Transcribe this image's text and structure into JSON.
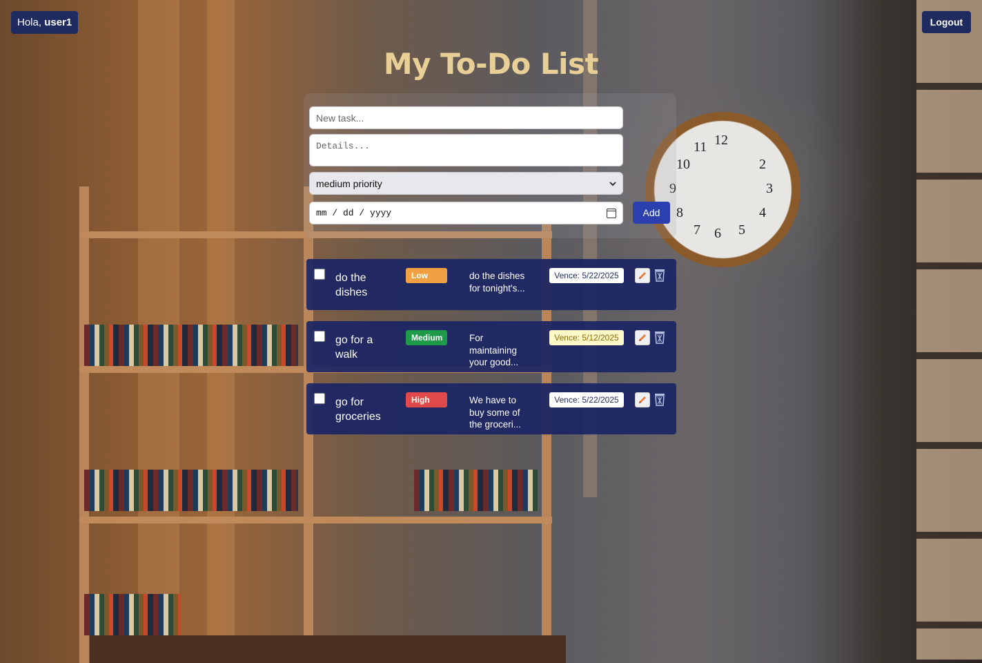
{
  "header": {
    "greeting_prefix": "Hola,",
    "username": "user1",
    "logout_label": "Logout"
  },
  "title": "My To-Do List",
  "form": {
    "task_placeholder": "New task...",
    "details_placeholder": "Details...",
    "priority_selected": "medium priority",
    "date_placeholder": "mm / dd / yyyy",
    "add_label": "Add"
  },
  "tasks": [
    {
      "name": "do the dishes",
      "priority": "Low",
      "priority_color": "#f0a040",
      "description": "do the dishes for tonight's...",
      "due": "Vence: 5/22/2025",
      "due_style": "normal"
    },
    {
      "name": "go for a walk",
      "priority": "Medium",
      "priority_color": "#1f9a4a",
      "description": "For maintaining your good...",
      "due": "Vence: 5/12/2025",
      "due_style": "warning"
    },
    {
      "name": "go for groceries",
      "priority": "High",
      "priority_color": "#e04a4a",
      "description": "We have to buy some of the groceri...",
      "due": "Vence: 5/22/2025",
      "due_style": "normal"
    }
  ],
  "icons": {
    "edit": "pencil-icon",
    "delete": "trash-icon",
    "calendar": "calendar-icon"
  }
}
